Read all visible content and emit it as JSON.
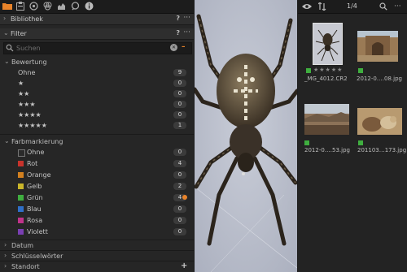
{
  "left_panel": {
    "toolbar": {
      "icons": [
        "folder-icon",
        "clipboard-icon",
        "aperture-icon",
        "cloud-icon",
        "chat-icon",
        "info-icon"
      ]
    },
    "library": {
      "label": "Bibliothek",
      "help": "?",
      "more": "···"
    },
    "filter": {
      "label": "Filter",
      "help": "?",
      "more": "···"
    },
    "search": {
      "placeholder": "Suchen",
      "clear": "✕",
      "menu": "–"
    },
    "rating": {
      "label": "Bewertung",
      "items": [
        {
          "label": "Ohne",
          "count": "9"
        },
        {
          "label": "★",
          "count": "0"
        },
        {
          "label": "★★",
          "count": "0"
        },
        {
          "label": "★★★",
          "count": "0"
        },
        {
          "label": "★★★★",
          "count": "0"
        },
        {
          "label": "★★★★★",
          "count": "1"
        }
      ]
    },
    "color_tag": {
      "label": "Farbmarkierung",
      "items": [
        {
          "label": "Ohne",
          "count": "0",
          "color": "#2a2a2a"
        },
        {
          "label": "Rot",
          "count": "4",
          "color": "#c8332c"
        },
        {
          "label": "Orange",
          "count": "0",
          "color": "#d2801f"
        },
        {
          "label": "Gelb",
          "count": "2",
          "color": "#c9b52a"
        },
        {
          "label": "Grün",
          "count": "4",
          "color": "#3fae3f"
        },
        {
          "label": "Blau",
          "count": "0",
          "color": "#2f6fc8"
        },
        {
          "label": "Rosa",
          "count": "0",
          "color": "#c0338a"
        },
        {
          "label": "Violett",
          "count": "0",
          "color": "#7a3fb3"
        }
      ]
    },
    "collapsed_sections": [
      {
        "label": "Datum"
      },
      {
        "label": "Schlüsselwörter"
      },
      {
        "label": "Standort",
        "action": "+"
      }
    ]
  },
  "browser": {
    "counter": "1/4",
    "thumbnails": [
      {
        "caption": "_MG_4012.CR2",
        "stars": "★★★★★"
      },
      {
        "caption": "2012-0….08.jpg"
      },
      {
        "caption": "2012-0….53.jpg"
      },
      {
        "caption": "201103…173.jpg"
      }
    ]
  },
  "colors": {
    "accent": "#e8832a",
    "selected_border": "#e0e0e0",
    "green_tag": "#3fae3f"
  }
}
